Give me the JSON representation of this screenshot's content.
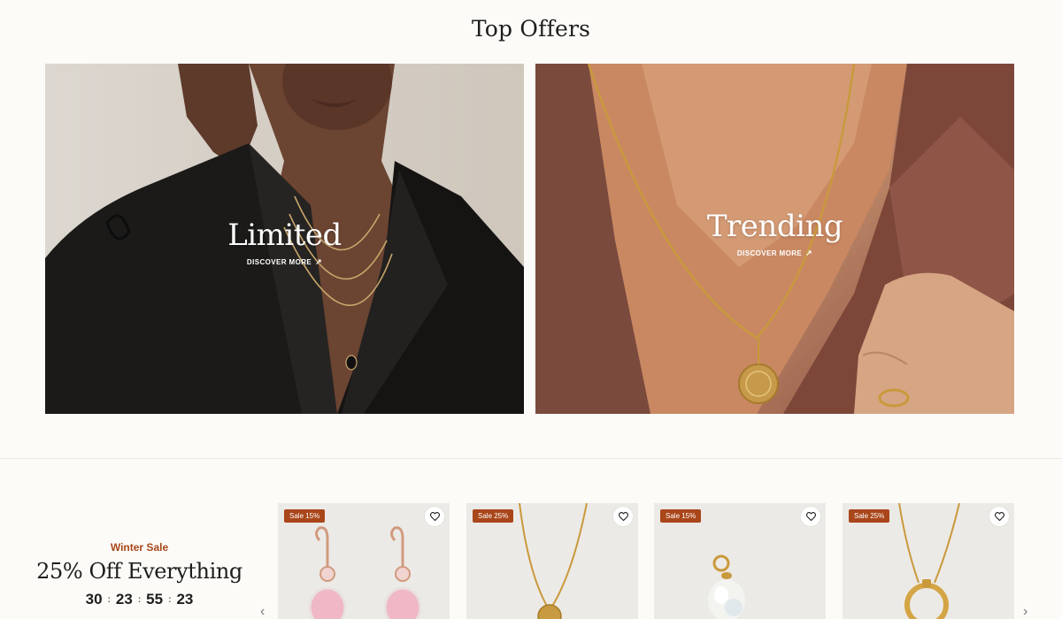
{
  "top_offers": {
    "title": "Top Offers",
    "banners": [
      {
        "title": "Limited",
        "link_label": "DISCOVER MORE"
      },
      {
        "title": "Trending",
        "link_label": "DISCOVER MORE"
      }
    ]
  },
  "winter_sale": {
    "eyebrow": "Winter Sale",
    "headline": "25% Off Everything",
    "countdown": [
      "30",
      "23",
      "55",
      "23"
    ]
  },
  "products": [
    {
      "badge": "Sale 15%",
      "image": "rose-gold-crystal-earrings"
    },
    {
      "badge": "Sale 25%",
      "image": "gold-coin-pendant-necklace"
    },
    {
      "badge": "Sale 15%",
      "image": "pearl-drop-charm"
    },
    {
      "badge": "Sale 25%",
      "image": "gold-ring-pendant-necklace"
    }
  ],
  "colors": {
    "background": "#fcfbf8",
    "accent": "#a9461a",
    "card": "#eceae6"
  }
}
